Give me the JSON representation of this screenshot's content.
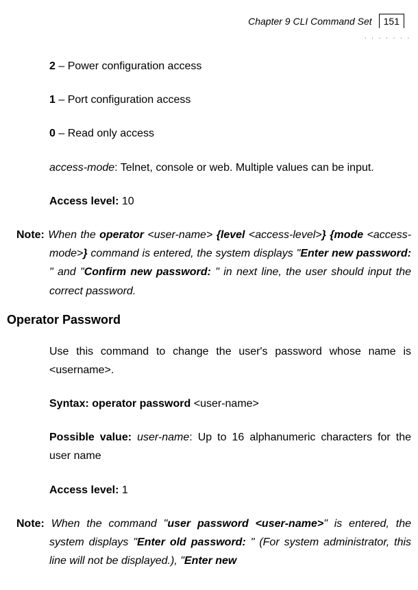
{
  "header": {
    "chapter": "Chapter 9 CLI Command Set",
    "page": "151"
  },
  "body": {
    "level2": {
      "num": "2",
      "text": " – Power configuration access"
    },
    "level1": {
      "num": "1",
      "text": " – Port configuration access"
    },
    "level0": {
      "num": "0",
      "text": " – Read only access"
    },
    "accessmode": {
      "term": "access-mode",
      "rest": ": Telnet, console or web. Multiple values can be input."
    },
    "accesslevel10": {
      "label": "Access level:",
      "value": " 10"
    },
    "note1": {
      "noteLabel": "Note:",
      "t1": " When the ",
      "operator": "operator",
      "t2": " <user-name> ",
      "level": "{level",
      "t3": " <access-level>",
      "brace1": "}",
      "mode": " {mode",
      "t4": " <access-mode>",
      "brace2": "}",
      "t5": " command is entered, the system displays \"",
      "enter": "Enter new password",
      "colon1": ": ",
      "t6": "\" and \"",
      "confirm": "Confirm new password",
      "colon2": ": ",
      "t7": "\" in next line, the user should input the correct password."
    },
    "heading": "Operator Password",
    "usecmd": "Use this command to change the user's password whose name is <username>.",
    "syntax": {
      "label": "Syntax: operator password ",
      "arg": "<user-name>"
    },
    "possible": {
      "label": "Possible value: ",
      "term": "user-name",
      "rest": ": Up to 16 alphanumeric characters for the user name"
    },
    "accesslevel1": {
      "label": "Access level:",
      "value": " 1"
    },
    "note2": {
      "noteLabel": "Note:",
      "t1": " When the command \"",
      "cmd": "user password <user-name>",
      "t2": "\" is entered, the system displays  \"",
      "enterold": "Enter old password",
      "colon1": ": ",
      "t3": "\" (For system administrator, this line will not be displayed.), \"",
      "enternew": "Enter new"
    }
  }
}
